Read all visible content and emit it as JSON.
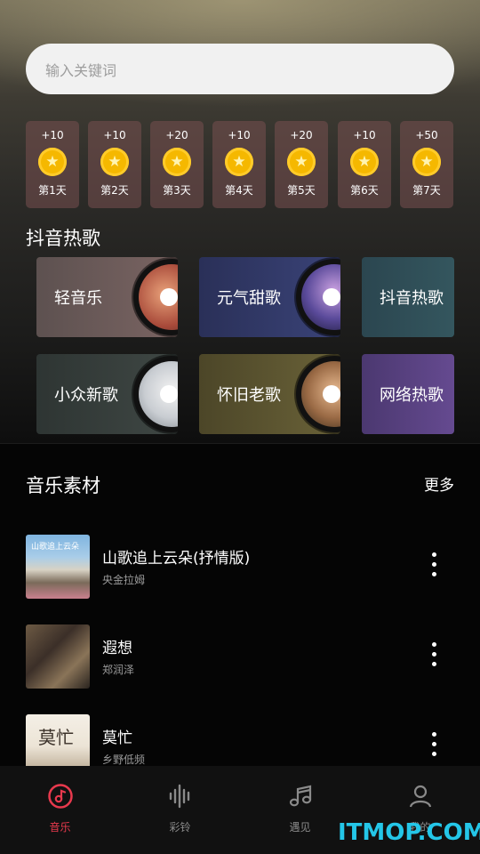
{
  "search": {
    "placeholder": "输入关键词"
  },
  "checkin": {
    "days": [
      {
        "points": "+10",
        "label": "第1天"
      },
      {
        "points": "+10",
        "label": "第2天"
      },
      {
        "points": "+20",
        "label": "第3天"
      },
      {
        "points": "+10",
        "label": "第4天"
      },
      {
        "points": "+20",
        "label": "第5天"
      },
      {
        "points": "+10",
        "label": "第6天"
      },
      {
        "points": "+50",
        "label": "第7天"
      }
    ],
    "coin_color": "#f5b800"
  },
  "hot": {
    "title": "抖音热歌",
    "genres": [
      {
        "label": "轻音乐",
        "color": "#6a5a57"
      },
      {
        "label": "元气甜歌",
        "color": "#2f3560"
      },
      {
        "label": "抖音热歌",
        "color": "#2f4d56"
      },
      {
        "label": "小众新歌",
        "color": "#333b38"
      },
      {
        "label": "怀旧老歌",
        "color": "#5e5632"
      },
      {
        "label": "网络热歌",
        "color": "#5a3f7a"
      }
    ]
  },
  "material": {
    "title": "音乐素材",
    "more": "更多",
    "songs": [
      {
        "title": "山歌追上云朵(抒情版)",
        "artist": "央金拉姆",
        "cover_text": "山歌追上云朵"
      },
      {
        "title": "遐想",
        "artist": "郑润泽",
        "cover_text": ""
      },
      {
        "title": "莫忙",
        "artist": "乡野低频",
        "cover_text": "莫忙"
      }
    ]
  },
  "tabs": [
    {
      "label": "音乐",
      "icon": "music-disc-icon",
      "active": true
    },
    {
      "label": "彩铃",
      "icon": "waveform-icon",
      "active": false
    },
    {
      "label": "遇见",
      "icon": "music-note-icon",
      "active": false
    },
    {
      "label": "我的",
      "icon": "user-icon",
      "active": false
    }
  ],
  "accent_color": "#e8394d",
  "watermark": "ITMOP.COM"
}
